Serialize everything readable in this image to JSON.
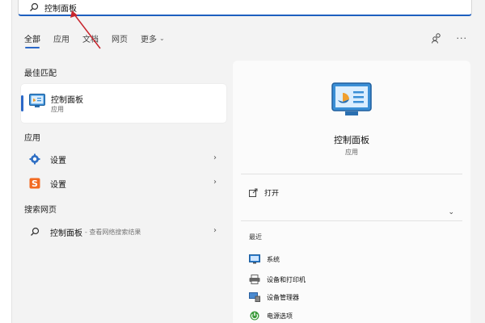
{
  "search": {
    "query": "控制面板"
  },
  "tabs": [
    {
      "label": "全部",
      "active": true
    },
    {
      "label": "应用"
    },
    {
      "label": "文档"
    },
    {
      "label": "网页"
    },
    {
      "label": "更多"
    }
  ],
  "sections": {
    "best_match": "最佳匹配",
    "apps": "应用",
    "web": "搜索网页"
  },
  "best_match": {
    "title": "控制面板",
    "subtitle": "应用"
  },
  "apps": [
    {
      "label": "设置",
      "icon": "gear-icon"
    },
    {
      "label": "设置",
      "icon": "sogou-s-icon"
    }
  ],
  "web_result": {
    "label": "控制面板",
    "suffix": "- 查看网络搜索结果"
  },
  "details": {
    "title": "控制面板",
    "subtitle": "应用",
    "open_label": "打开",
    "recent_label": "最近",
    "recent_items": [
      {
        "label": "系统",
        "icon": "system-icon"
      },
      {
        "label": "设备和打印机",
        "icon": "printer-icon"
      },
      {
        "label": "设备管理器",
        "icon": "device-manager-icon"
      },
      {
        "label": "电源选项",
        "icon": "power-options-icon"
      }
    ]
  },
  "colors": {
    "accent": "#2b68c8",
    "arrow": "#c8262e",
    "panel_bg": "#fbfbfb",
    "page_bg": "#f3f3f3"
  }
}
